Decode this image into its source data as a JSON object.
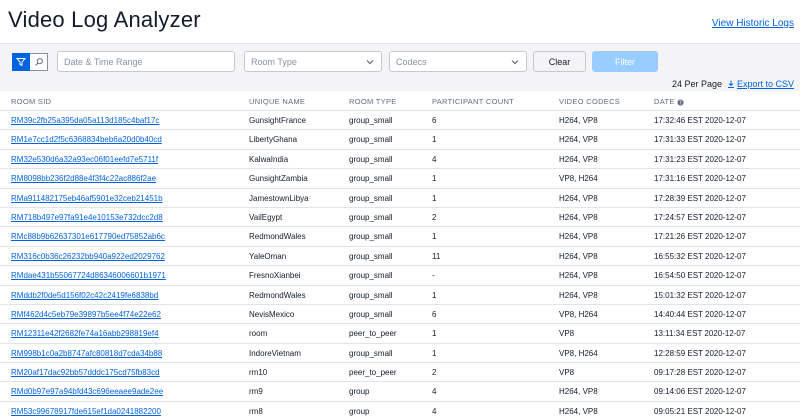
{
  "header": {
    "title": "Video Log Analyzer",
    "historic_link": "View Historic Logs"
  },
  "filters": {
    "date_placeholder": "Date & Time Range",
    "room_type_placeholder": "Room Type",
    "codecs_placeholder": "Codecs",
    "clear_label": "Clear",
    "filter_label": "Filter",
    "active_toggle_icon": "filter-icon",
    "inactive_toggle_icon": "search-icon"
  },
  "pagination": {
    "per_page_label": "24 Per Page",
    "export_label": "Export to CSV"
  },
  "table": {
    "columns": [
      "ROOM SID",
      "UNIQUE NAME",
      "ROOM TYPE",
      "PARTICIPANT COUNT",
      "VIDEO CODECS",
      "DATE"
    ],
    "rows": [
      [
        "RM39c2fb25a395da05a113d185c4baf17c",
        "GunsightFrance",
        "group_small",
        "6",
        "H264, VP8",
        "17:32:46 EST 2020-12-07"
      ],
      [
        "RM1e7cc1d2f5c6368834beb6a20d0b40cd",
        "LibertyGhana",
        "group_small",
        "1",
        "H264, VP8",
        "17:31:33 EST 2020-12-07"
      ],
      [
        "RM32e530d6a32a93ec06f01eefd7e5711f",
        "KalwaIndia",
        "group_small",
        "4",
        "H264, VP8",
        "17:31:23 EST 2020-12-07"
      ],
      [
        "RM8098bb236f2d88e4f3f4c22ac886f2ae",
        "GunsightZambia",
        "group_small",
        "1",
        "VP8, H264",
        "17:31:16 EST 2020-12-07"
      ],
      [
        "RMa911482175eb46af5901e32ceb21451b",
        "JamestownLibya",
        "group_small",
        "1",
        "H264, VP8",
        "17:28:39 EST 2020-12-07"
      ],
      [
        "RM718b497e97fa91e4e10153e732dcc2d8",
        "VailEgypt",
        "group_small",
        "2",
        "H264, VP8",
        "17:24:57 EST 2020-12-07"
      ],
      [
        "RMc88b9b62637301e617790ed75852ab6c",
        "RedmondWales",
        "group_small",
        "1",
        "H264, VP8",
        "17:21:26 EST 2020-12-07"
      ],
      [
        "RM316c0b36c26232bb940a922ed2029762",
        "YaleOman",
        "group_small",
        "11",
        "H264, VP8",
        "16:55:32 EST 2020-12-07"
      ],
      [
        "RMdae431b55067724d86346006601b1971",
        "FresnoXianbei",
        "group_small",
        "-",
        "H264, VP8",
        "16:54:50 EST 2020-12-07"
      ],
      [
        "RMddb2f0de5d156f02c42c2419fe6838bd",
        "RedmondWales",
        "group_small",
        "1",
        "H264, VP8",
        "15:01:32 EST 2020-12-07"
      ],
      [
        "RMf462d4c5eb79e39897b5ee4f74e22e62",
        "NevisMexico",
        "group_small",
        "6",
        "VP8, H264",
        "14:40:44 EST 2020-12-07"
      ],
      [
        "RM12311e42f2682fe74a16abb298819ef4",
        "room",
        "peer_to_peer",
        "1",
        "VP8",
        "13:11:34 EST 2020-12-07"
      ],
      [
        "RM998b1c0a2b8747afc80818d7cda34b88",
        "IndoreVietnam",
        "group_small",
        "1",
        "VP8, H264",
        "12:28:59 EST 2020-12-07"
      ],
      [
        "RM20af17dac92bb57dddc175cd75fb83cd",
        "rm10",
        "peer_to_peer",
        "2",
        "VP8",
        "09:17:28 EST 2020-12-07"
      ],
      [
        "RMd0b97e97a94bfd43c696eeaee9ade2ee",
        "rm9",
        "group",
        "4",
        "H264, VP8",
        "09:14:06 EST 2020-12-07"
      ],
      [
        "RM53c99678917fde615ef1da0241882200",
        "rm8",
        "group",
        "4",
        "H264, VP8",
        "09:05:21 EST 2020-12-07"
      ]
    ]
  }
}
